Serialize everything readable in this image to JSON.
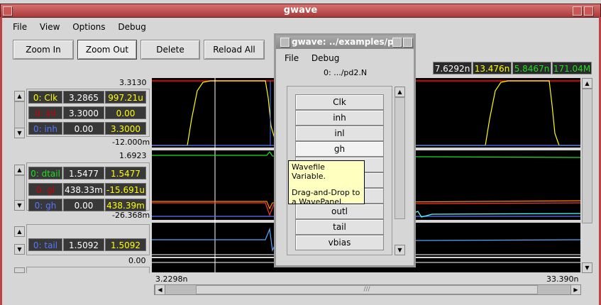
{
  "main": {
    "title": "gwave",
    "menu": [
      "File",
      "View",
      "Options",
      "Debug"
    ],
    "toolbar": {
      "zoom_in": "Zoom In",
      "zoom_out": "Zoom Out",
      "delete": "Delete",
      "reload": "Reload All"
    },
    "readouts": [
      {
        "text": "7.6292n",
        "color": "#ffffff"
      },
      {
        "text": "13.476n",
        "color": "#ffff00"
      },
      {
        "text": "5.8467n",
        "color": "#22dd22"
      },
      {
        "text": "171.04M",
        "color": "#22dd22"
      }
    ],
    "panels": [
      {
        "ymax": "3.3130",
        "ymin": "-12.000m",
        "rows": [
          {
            "name": "0: Clk",
            "name_color": "#ffff00",
            "v1": "3.2865",
            "v2": "997.21u"
          },
          {
            "name": "0: inl",
            "name_color": "#cc0000",
            "v1": "3.3000",
            "v2": "0.00"
          },
          {
            "name": "0: inh",
            "name_color": "#5577ff",
            "v1": "0.00",
            "v2": "3.3000"
          }
        ]
      },
      {
        "ymax": "1.6923",
        "ymin": "-26.368m",
        "rows": [
          {
            "name": "0: dtail",
            "name_color": "#22dd22",
            "v1": "1.5477",
            "v2": "1.5477"
          },
          {
            "name": "0: gl",
            "name_color": "#cc0000",
            "v1": "438.33m",
            "v2": "-15.691u"
          },
          {
            "name": "0: gh",
            "name_color": "#5577ff",
            "v1": "0.00",
            "v2": "438.39m"
          }
        ]
      },
      {
        "ymax": "",
        "ymin": "0.00",
        "rows": [
          {
            "name": "0: tail",
            "name_color": "#5577ff",
            "v1": "1.5092",
            "v2": "1.5092"
          }
        ]
      }
    ],
    "x_axis": {
      "start": "3.2298n",
      "end": "33.390n"
    }
  },
  "popup": {
    "title": "gwave: ../examples/pd",
    "menu": [
      "File",
      "Debug"
    ],
    "filename": "0: .../pd2.N",
    "variables": [
      "Clk",
      "inh",
      "inl",
      "gh",
      "",
      "",
      "",
      "outl",
      "tail",
      "vbias"
    ],
    "tooltip_line1": "Wavefile Variable.",
    "tooltip_line2": "Drag-and-Drop to",
    "tooltip_line3": "a WavePanel."
  },
  "colors": {
    "value_color": "#ffffff",
    "value2_color": "#ffff00"
  }
}
